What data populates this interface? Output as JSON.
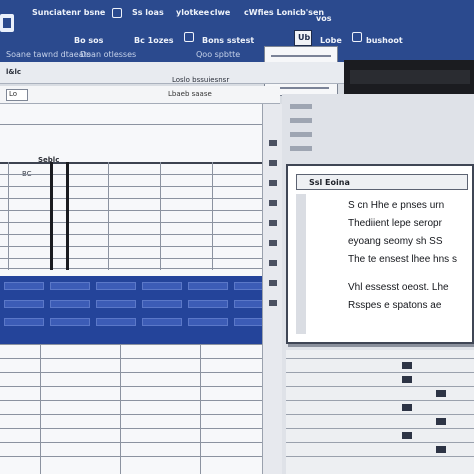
{
  "ribbon": {
    "row1": [
      "Sunciatenr bsne",
      "Ss loas",
      "ylotkee",
      "clwe",
      "cWfies Lonic",
      "b'sen",
      "vos"
    ],
    "row2": [
      "Bo sos",
      "Bc 1ozes",
      "Bons sstest",
      "Lobe",
      "bushoot"
    ],
    "row3": [
      "Soane tawnd dtaeats",
      "Doan otlesses",
      "Qoo spbtte"
    ]
  },
  "popup": {
    "label": "Ub"
  },
  "toolbar": {
    "left_tag": "l&lc",
    "cell_ref": "Loslo bssuiesnsr"
  },
  "formula": {
    "name_box": "Lo",
    "text": "Lbaeb saase"
  },
  "sheet": {
    "col_header": "Seblc",
    "row_tag": "BC"
  },
  "dialog": {
    "title": "Ssl Eoina",
    "lines": [
      "S cn Hhe e pnses urn",
      "Thediient lepe seropr",
      "eyoang seomy sh SS",
      "The te ensest lhee hns s",
      "Vhl essesst oeost. Lhe",
      "Rsspes e spatons ae"
    ]
  }
}
